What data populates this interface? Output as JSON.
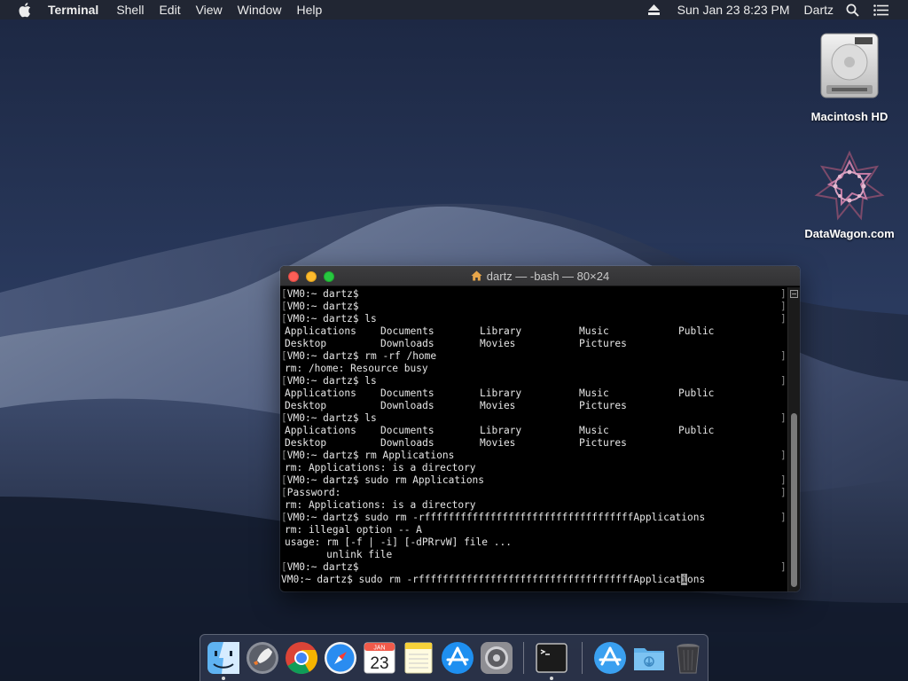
{
  "menubar": {
    "app_name": "Terminal",
    "menus": [
      "Shell",
      "Edit",
      "View",
      "Window",
      "Help"
    ],
    "datetime": "Sun Jan 23  8:23 PM",
    "user": "Dartz"
  },
  "desktop": {
    "icons": [
      {
        "label": "Macintosh HD",
        "icon": "hard-drive-icon"
      },
      {
        "label": "DataWagon.com",
        "icon": "datawagon-logo-icon"
      }
    ]
  },
  "terminal": {
    "title": "dartz — -bash — 80×24",
    "lines": [
      {
        "kind": "prompt",
        "text": "VM0:~ dartz$ "
      },
      {
        "kind": "prompt",
        "text": "VM0:~ dartz$ "
      },
      {
        "kind": "prompt",
        "text": "VM0:~ dartz$ ls"
      },
      {
        "kind": "cols",
        "cells": [
          "Applications",
          "Documents",
          "Library",
          "Music",
          "Public"
        ]
      },
      {
        "kind": "cols",
        "cells": [
          "Desktop",
          "Downloads",
          "Movies",
          "Pictures",
          ""
        ]
      },
      {
        "kind": "prompt",
        "text": "VM0:~ dartz$ rm -rf /home"
      },
      {
        "kind": "out",
        "text": "rm: /home: Resource busy"
      },
      {
        "kind": "prompt",
        "text": "VM0:~ dartz$ ls"
      },
      {
        "kind": "cols",
        "cells": [
          "Applications",
          "Documents",
          "Library",
          "Music",
          "Public"
        ]
      },
      {
        "kind": "cols",
        "cells": [
          "Desktop",
          "Downloads",
          "Movies",
          "Pictures",
          ""
        ]
      },
      {
        "kind": "prompt",
        "text": "VM0:~ dartz$ ls"
      },
      {
        "kind": "cols",
        "cells": [
          "Applications",
          "Documents",
          "Library",
          "Music",
          "Public"
        ]
      },
      {
        "kind": "cols",
        "cells": [
          "Desktop",
          "Downloads",
          "Movies",
          "Pictures",
          ""
        ]
      },
      {
        "kind": "prompt",
        "text": "VM0:~ dartz$ rm Applications"
      },
      {
        "kind": "out",
        "text": "rm: Applications: is a directory"
      },
      {
        "kind": "prompt",
        "text": "VM0:~ dartz$ sudo rm Applications"
      },
      {
        "kind": "prompt",
        "text": "Password:"
      },
      {
        "kind": "out",
        "text": "rm: Applications: is a directory"
      },
      {
        "kind": "prompt",
        "text": "VM0:~ dartz$ sudo rm -rfffffffffffffffffffffffffffffffffffApplications"
      },
      {
        "kind": "out",
        "text": "rm: illegal option -- A"
      },
      {
        "kind": "out",
        "text": "usage: rm [-f | -i] [-dPRrvW] file ..."
      },
      {
        "kind": "out",
        "text": "       unlink file"
      },
      {
        "kind": "prompt",
        "text": "VM0:~ dartz$ "
      },
      {
        "kind": "current",
        "before": "VM0:~ dartz$ sudo rm -rffffffffffffffffffffffffffffffffffffApplicat",
        "cursor": "i",
        "after": "ons"
      }
    ]
  },
  "dock": {
    "items": [
      "Finder",
      "Launchpad",
      "Google Chrome",
      "Safari",
      "Calendar",
      "Notes",
      "App Store",
      "System Preferences",
      "Terminal",
      "Applications",
      "Downloads",
      "Trash"
    ],
    "calendar": {
      "month": "JAN",
      "day": "23"
    }
  },
  "colors": {
    "menubar_bg": "#222632",
    "terminal_bg": "#000000",
    "terminal_text": "#e6e6e6",
    "close": "#fc5f57",
    "minimize": "#fdbb2d",
    "zoom": "#27c840"
  }
}
